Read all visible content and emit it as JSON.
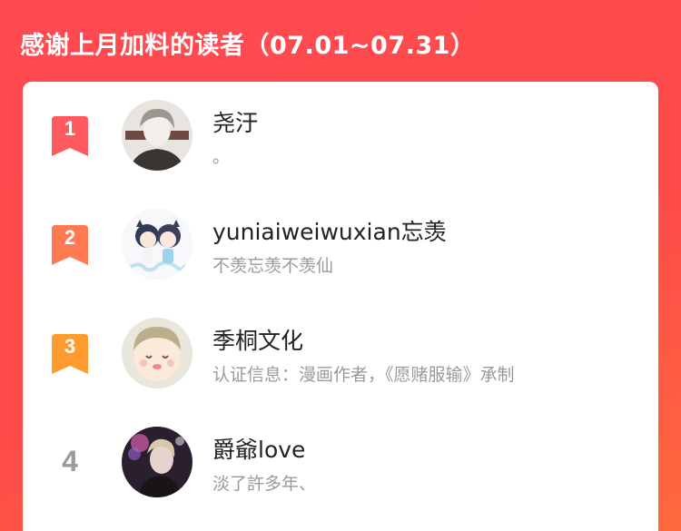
{
  "header": {
    "title": "感谢上月加料的读者（07.01~07.31）"
  },
  "readers": [
    {
      "rank": "1",
      "name": "尧汙",
      "desc": "。",
      "rank_color": "#ff5a5f"
    },
    {
      "rank": "2",
      "name": "yuniaiweiwuxian忘羡",
      "desc": "不羡忘羡不羡仙",
      "rank_color": "#ff7a52"
    },
    {
      "rank": "3",
      "name": "季桐文化",
      "desc": "认证信息：漫画作者，《愿赌服输》承制",
      "rank_color": "#ff9a2e"
    },
    {
      "rank": "4",
      "name": "爵爺love",
      "desc": "淡了許多年、"
    }
  ]
}
